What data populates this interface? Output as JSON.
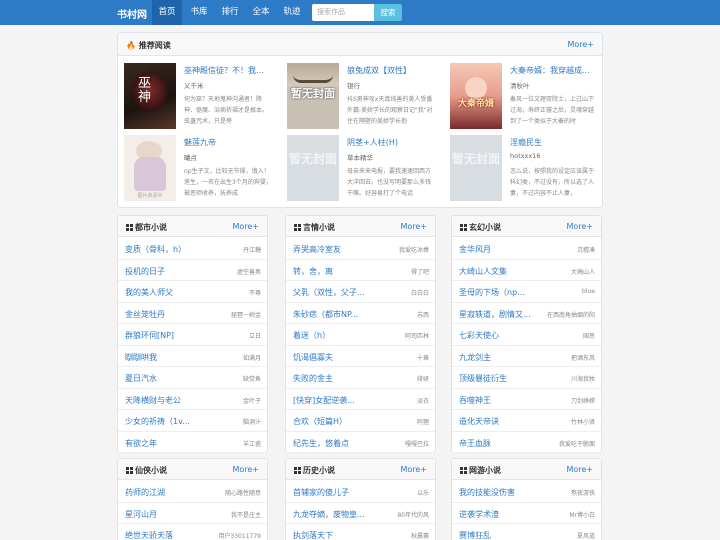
{
  "brand": "书村网",
  "nav": [
    {
      "label": "首页",
      "active": true
    },
    {
      "label": "书库",
      "active": false
    },
    {
      "label": "排行",
      "active": false
    },
    {
      "label": "全本",
      "active": false
    },
    {
      "label": "轨迹",
      "active": false
    }
  ],
  "search": {
    "placeholder": "搜索作品",
    "button": "搜索"
  },
  "recommend": {
    "title": "推荐阅读",
    "more": "More+",
    "books": [
      {
        "title": "巫神殿信徒？不！我...",
        "author": "乂千米",
        "desc": "何为巫？天地鬼神沟通者！降神、驱魔、治病祈福才是根本。虫蛊咒术，只是旁",
        "cover": "ink"
      },
      {
        "title": "狼兔成双【双性】",
        "author": "银行",
        "desc": "抖S男神攻x天真纯善的美人受番外篇:美娇学长的观察日记\"我\"对住在隔壁的美娇学长抱",
        "cover": "noimg",
        "cover_text": "暂无封面"
      },
      {
        "title": "大秦帝婿：我穿越成...",
        "author": "清秋叶",
        "desc": "秦风一位文理双院士，上过山下过海，寿终正寝之后，灵魂穿越到了一个类似于大秦的时",
        "cover": "qin",
        "cover_text": "大秦帝婿"
      },
      {
        "title": "魅莲九帝",
        "author": "曦点",
        "desc": "np生子文，比较无节操，慎入！莲生，一名在出生3个月的奔婴，被恶师收养，抚养成",
        "cover": "girl",
        "cover_sub": "图片来源中"
      },
      {
        "title": "阴茎+人柱(H)",
        "author": "草本精华",
        "desc": "母亲来来电报，要我速速回西方大洋回去。也没写明要那么多钱干嘛。好容易打了个电话",
        "cover": "pale",
        "cover_text": "暂无封面"
      },
      {
        "title": "淫瘾民生",
        "author": "hotxxx16",
        "desc": "怎么说，按照我的设定应该属于科幻类，不过没有，所以选了人妻，不过内容不止人妻，",
        "cover": "pale",
        "cover_text": "暂无封面"
      }
    ]
  },
  "lists": [
    {
      "title": "都市小说",
      "more": "More+",
      "rows": [
        {
          "t": "变质（骨科，h）",
          "a": "丹江糖"
        },
        {
          "t": "投机的日子",
          "a": "虚空善男"
        },
        {
          "t": "我的美人师父",
          "a": "不尊"
        },
        {
          "t": "金丝笼牡丹",
          "a": "琵琶一树金"
        },
        {
          "t": "群狼环伺[NP]",
          "a": "立日"
        },
        {
          "t": "瞓瞓哄我",
          "a": "如满月"
        },
        {
          "t": "夏日汽水",
          "a": "缺觉鱼"
        },
        {
          "t": "天降横财与老公",
          "a": "金叶子"
        },
        {
          "t": "少女的祈祷（1v...",
          "a": "脑洞汁"
        },
        {
          "t": "有欲之年",
          "a": "羊江瓷"
        }
      ]
    },
    {
      "title": "言情小说",
      "more": "More+",
      "rows": [
        {
          "t": "弄哭高冷室友",
          "a": "我爱吃冰棒"
        },
        {
          "t": "转，舍，离",
          "a": "得了吧"
        },
        {
          "t": "父乳（双性，父子...",
          "a": "白白白"
        },
        {
          "t": "朱砂痣（都市NP...",
          "a": "苏西"
        },
        {
          "t": "着迷（h）",
          "a": "阿司匹林"
        },
        {
          "t": "饥渴倡寡夫",
          "a": "十章"
        },
        {
          "t": "失败的金主",
          "a": "绯妍"
        },
        {
          "t": "[快穿]女配逆袭...",
          "a": "淡衣"
        },
        {
          "t": "合欢（短篇H）",
          "a": "阿狸"
        },
        {
          "t": "纪先生，悠着点",
          "a": "嘎嘎巴拉"
        }
      ]
    },
    {
      "title": "玄幻小说",
      "more": "More+",
      "rows": [
        {
          "t": "金华风月",
          "a": "沉檀凑"
        },
        {
          "t": "大崎山人文集",
          "a": "大崎山人"
        },
        {
          "t": "圣母的下场（np...",
          "a": "blue"
        },
        {
          "t": "星寂轶道，剧情又...",
          "a": "在西南角抽烟的阳"
        },
        {
          "t": "七彩天使心",
          "a": "国思"
        },
        {
          "t": "九龙剑主",
          "a": "把酒东风"
        },
        {
          "t": "顶级暴徒衍生",
          "a": "川海我牧"
        },
        {
          "t": "吞噬神王",
          "a": "刀剑峥嵘"
        },
        {
          "t": "造化天帝诀",
          "a": "竹林小贤"
        },
        {
          "t": "帝王血脉",
          "a": "我爱吃干脆面"
        }
      ]
    },
    {
      "title": "仙侠小说",
      "more": "More+",
      "rows": [
        {
          "t": "药师的江湖",
          "a": "随心路性随意"
        },
        {
          "t": "星河山月",
          "a": "我不是庄主"
        },
        {
          "t": "绝世天骄天落",
          "a": "用户33011779"
        }
      ]
    },
    {
      "title": "历史小说",
      "more": "More+",
      "rows": [
        {
          "t": "首辅家的傻儿子",
          "a": "以乐"
        },
        {
          "t": "九龙夺嫡，废物皇...",
          "a": "80年代的风"
        },
        {
          "t": "执剑落天下",
          "a": "秋晨赛"
        }
      ]
    },
    {
      "title": "网游小说",
      "more": "More+",
      "rows": [
        {
          "t": "我的技能没伤害",
          "a": "熬夜游侠"
        },
        {
          "t": "逆袭学术渣",
          "a": "Mr博小白"
        },
        {
          "t": "赛博狂乱",
          "a": "夏风道"
        }
      ]
    }
  ]
}
